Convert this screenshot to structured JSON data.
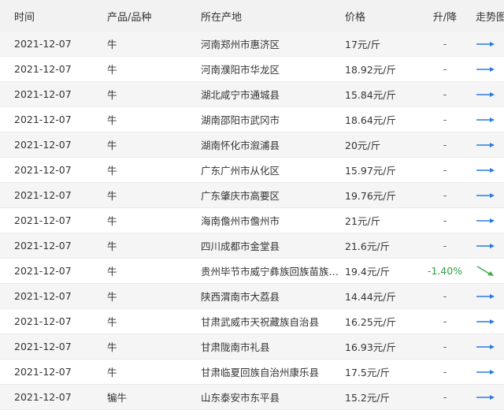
{
  "headers": {
    "date": "时间",
    "product": "产品/品种",
    "location": "所在产地",
    "price": "价格",
    "change": "升/降",
    "trend": "走势图"
  },
  "colors": {
    "flat_arrow": "#2a7be4",
    "down_arrow": "#3fa94a",
    "down_text": "#2ea043"
  },
  "rows": [
    {
      "date": "2021-12-07",
      "product": "牛",
      "location": "河南郑州市惠济区",
      "price": "17元/斤",
      "change": "-",
      "trend": "flat-arrow-icon"
    },
    {
      "date": "2021-12-07",
      "product": "牛",
      "location": "河南濮阳市华龙区",
      "price": "18.92元/斤",
      "change": "-",
      "trend": "flat-arrow-icon"
    },
    {
      "date": "2021-12-07",
      "product": "牛",
      "location": "湖北咸宁市通城县",
      "price": "15.84元/斤",
      "change": "-",
      "trend": "flat-arrow-icon"
    },
    {
      "date": "2021-12-07",
      "product": "牛",
      "location": "湖南邵阳市武冈市",
      "price": "18.64元/斤",
      "change": "-",
      "trend": "flat-arrow-icon"
    },
    {
      "date": "2021-12-07",
      "product": "牛",
      "location": "湖南怀化市溆浦县",
      "price": "20元/斤",
      "change": "-",
      "trend": "flat-arrow-icon"
    },
    {
      "date": "2021-12-07",
      "product": "牛",
      "location": "广东广州市从化区",
      "price": "15.97元/斤",
      "change": "-",
      "trend": "flat-arrow-icon"
    },
    {
      "date": "2021-12-07",
      "product": "牛",
      "location": "广东肇庆市高要区",
      "price": "19.76元/斤",
      "change": "-",
      "trend": "flat-arrow-icon"
    },
    {
      "date": "2021-12-07",
      "product": "牛",
      "location": "海南儋州市儋州市",
      "price": "21元/斤",
      "change": "-",
      "trend": "flat-arrow-icon"
    },
    {
      "date": "2021-12-07",
      "product": "牛",
      "location": "四川成都市金堂县",
      "price": "21.6元/斤",
      "change": "-",
      "trend": "flat-arrow-icon"
    },
    {
      "date": "2021-12-07",
      "product": "牛",
      "location": "贵州毕节市威宁彝族回族苗族自...",
      "price": "19.4元/斤",
      "change": "-1.40%",
      "trend": "down-arrow-icon"
    },
    {
      "date": "2021-12-07",
      "product": "牛",
      "location": "陕西渭南市大荔县",
      "price": "14.44元/斤",
      "change": "-",
      "trend": "flat-arrow-icon"
    },
    {
      "date": "2021-12-07",
      "product": "牛",
      "location": "甘肃武威市天祝藏族自治县",
      "price": "16.25元/斤",
      "change": "-",
      "trend": "flat-arrow-icon"
    },
    {
      "date": "2021-12-07",
      "product": "牛",
      "location": "甘肃陇南市礼县",
      "price": "16.93元/斤",
      "change": "-",
      "trend": "flat-arrow-icon"
    },
    {
      "date": "2021-12-07",
      "product": "牛",
      "location": "甘肃临夏回族自治州康乐县",
      "price": "17.5元/斤",
      "change": "-",
      "trend": "flat-arrow-icon"
    },
    {
      "date": "2021-12-07",
      "product": "犏牛",
      "location": "山东泰安市东平县",
      "price": "15.2元/斤",
      "change": "-",
      "trend": "flat-arrow-icon"
    }
  ]
}
